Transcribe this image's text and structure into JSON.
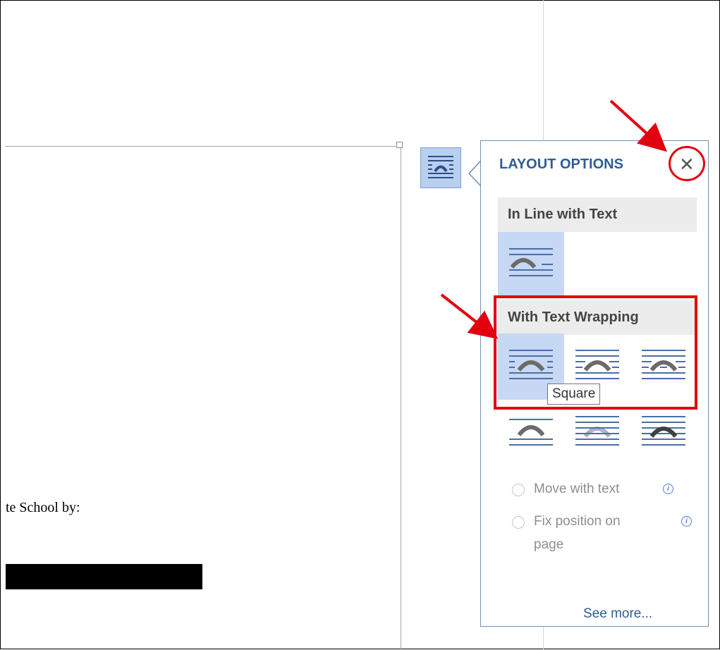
{
  "document": {
    "visible_text": "te School by:"
  },
  "layout_options": {
    "title": "LAYOUT OPTIONS",
    "close_glyph": "✕",
    "inline_heading": "In Line with Text",
    "wrapping_heading": "With Text Wrapping",
    "tooltip": "Square",
    "move_with_text": "Move with text",
    "fix_position_line1": "Fix position on",
    "fix_position_line2": "page",
    "see_more": "See more..."
  },
  "colors": {
    "accent": "#2e5d97",
    "selected_option": "#c6d8f3",
    "annotation_red": "#e3000f"
  },
  "icons": {
    "layout_options_button": "layout-wrap-icon",
    "close": "close-icon",
    "info": "info-icon"
  }
}
